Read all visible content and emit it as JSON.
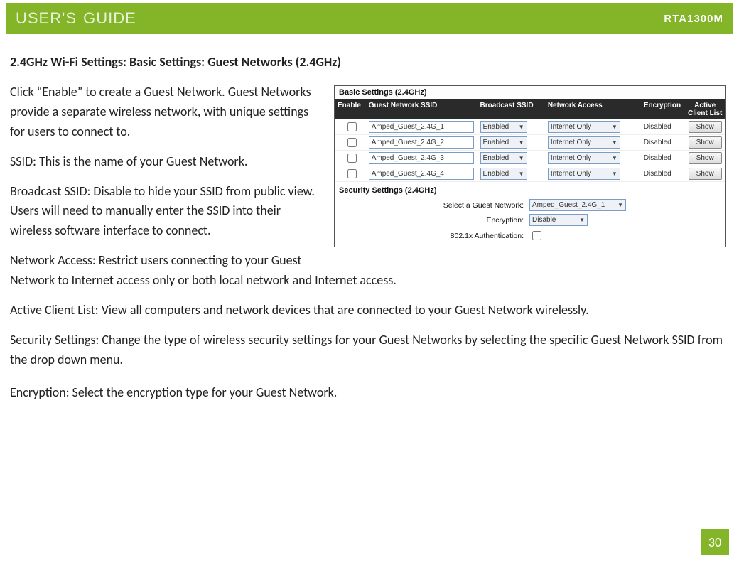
{
  "banner": {
    "title": "USER'S GUIDE",
    "model": "RTA1300M"
  },
  "section_title": "2.4GHz Wi-Fi Settings: Basic Settings: Guest Networks (2.4GHz)",
  "paragraphs": {
    "p1": "Click “Enable” to create a Guest Network. Guest Networks provide a separate wireless network, with unique settings for users to connect to.",
    "p2": "SSID: This is the name of your Guest Network.",
    "p3": "Broadcast SSID: Disable to hide your SSID from public view. Users will need to manually enter the SSID into their wireless software interface to connect.",
    "p4": "Network Access: Restrict users connecting to your Guest Network to Internet access only or both local network and Internet access.",
    "p5": "Active Client List: View all computers and network devices that are connected to your Guest Network wirelessly.",
    "p6": "Security Settings: Change the type of wireless security settings for your Guest Networks by selecting the specific Guest Network SSID from the drop down menu.",
    "p7": "Encryption: Select the encryption type for your Guest Network."
  },
  "panel": {
    "basic_head": "Basic Settings (2.4GHz)",
    "security_head": "Security Settings (2.4GHz)",
    "headers": {
      "enable": "Enable",
      "ssid": "Guest Network SSID",
      "bcast": "Broadcast SSID",
      "net": "Network Access",
      "enc": "Encryption",
      "list": "Active Client List"
    },
    "rows": [
      {
        "ssid": "Amped_Guest_2.4G_1",
        "bcast": "Enabled",
        "net": "Internet Only",
        "enc": "Disabled",
        "btn": "Show"
      },
      {
        "ssid": "Amped_Guest_2.4G_2",
        "bcast": "Enabled",
        "net": "Internet Only",
        "enc": "Disabled",
        "btn": "Show"
      },
      {
        "ssid": "Amped_Guest_2.4G_3",
        "bcast": "Enabled",
        "net": "Internet Only",
        "enc": "Disabled",
        "btn": "Show"
      },
      {
        "ssid": "Amped_Guest_2.4G_4",
        "bcast": "Enabled",
        "net": "Internet Only",
        "enc": "Disabled",
        "btn": "Show"
      }
    ],
    "security": {
      "select_label": "Select a Guest Network:",
      "select_value": "Amped_Guest_2.4G_1",
      "enc_label": "Encryption:",
      "enc_value": "Disable",
      "auth_label": "802.1x Authentication:"
    }
  },
  "page_number": "30"
}
